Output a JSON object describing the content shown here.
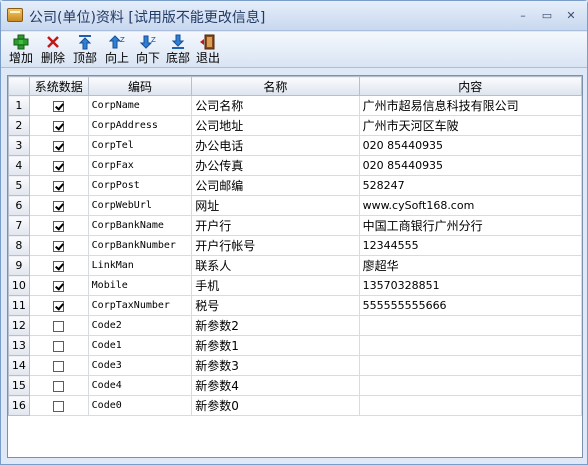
{
  "window": {
    "title": "公司(单位)资料  [试用版不能更改信息]",
    "controls": {
      "minimize": "–",
      "maximize": "▭",
      "close": "✕"
    }
  },
  "toolbar": {
    "add": "增加",
    "delete": "删除",
    "top": "顶部",
    "up": "向上",
    "down": "向下",
    "bottom": "底部",
    "exit": "退出"
  },
  "grid": {
    "columns": [
      "系统数据",
      "编码",
      "名称",
      "内容"
    ],
    "rows": [
      {
        "no": "1",
        "system": true,
        "code": "CorpName",
        "name": "公司名称",
        "value": "广州市超易信息科技有限公司"
      },
      {
        "no": "2",
        "system": true,
        "code": "CorpAddress",
        "name": "公司地址",
        "value": "广州市天河区车陂"
      },
      {
        "no": "3",
        "system": true,
        "code": "CorpTel",
        "name": "办公电话",
        "value": "020 85440935"
      },
      {
        "no": "4",
        "system": true,
        "code": "CorpFax",
        "name": "办公传真",
        "value": "020 85440935"
      },
      {
        "no": "5",
        "system": true,
        "code": "CorpPost",
        "name": "公司邮编",
        "value": "528247"
      },
      {
        "no": "6",
        "system": true,
        "code": "CorpWebUrl",
        "name": "网址",
        "value": "www.cySoft168.com"
      },
      {
        "no": "7",
        "system": true,
        "code": "CorpBankName",
        "name": "开户行",
        "value": "中国工商银行广州分行"
      },
      {
        "no": "8",
        "system": true,
        "code": "CorpBankNumber",
        "name": "开户行帐号",
        "value": "12344555"
      },
      {
        "no": "9",
        "system": true,
        "code": "LinkMan",
        "name": "联系人",
        "value": "廖超华"
      },
      {
        "no": "10",
        "system": true,
        "code": "Mobile",
        "name": "手机",
        "value": "13570328851"
      },
      {
        "no": "11",
        "system": true,
        "code": "CorpTaxNumber",
        "name": "税号",
        "value": "555555555666"
      },
      {
        "no": "12",
        "system": false,
        "code": "Code2",
        "name": "新参数2",
        "value": ""
      },
      {
        "no": "13",
        "system": false,
        "code": "Code1",
        "name": "新参数1",
        "value": ""
      },
      {
        "no": "14",
        "system": false,
        "code": "Code3",
        "name": "新参数3",
        "value": ""
      },
      {
        "no": "15",
        "system": false,
        "code": "Code4",
        "name": "新参数4",
        "value": ""
      },
      {
        "no": "16",
        "system": false,
        "code": "Code0",
        "name": "新参数0",
        "value": ""
      }
    ]
  }
}
